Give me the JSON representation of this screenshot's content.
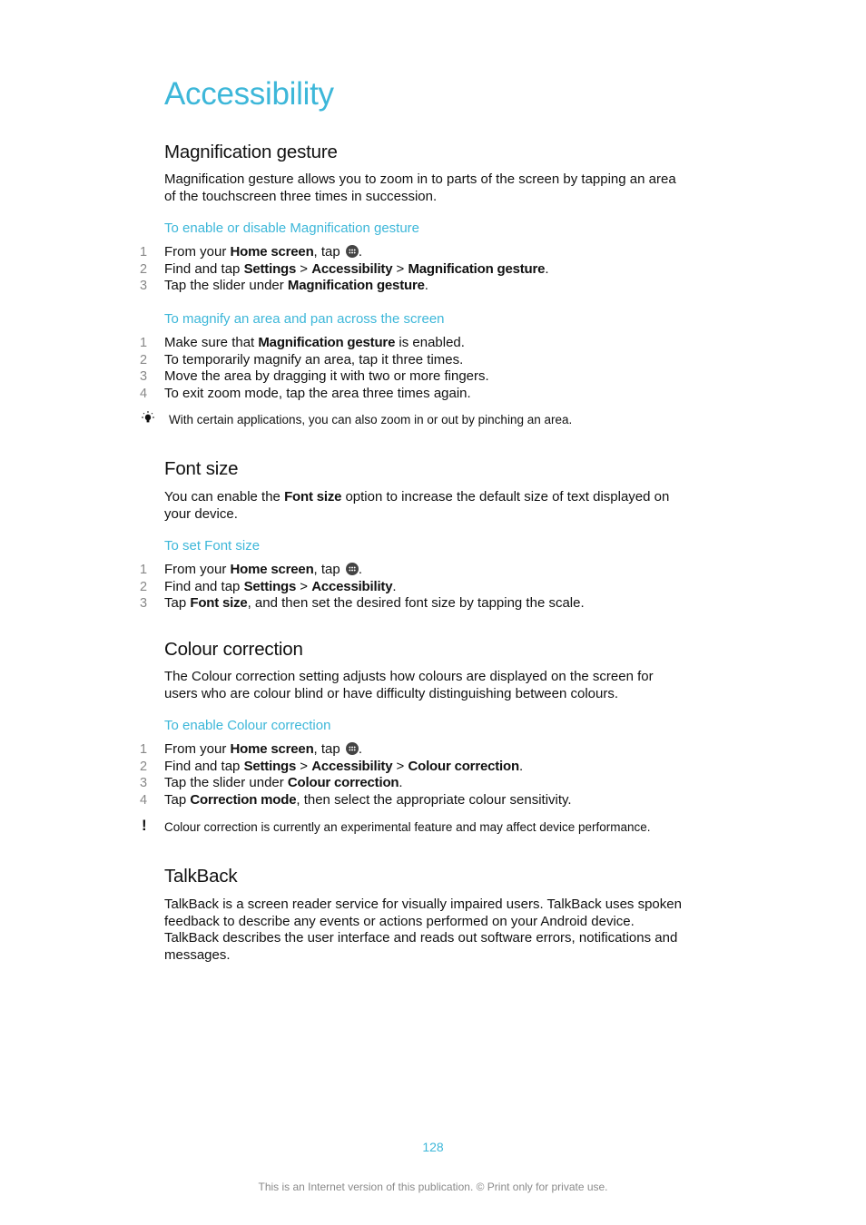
{
  "title": "Accessibility",
  "sections": {
    "magnification": {
      "heading": "Magnification gesture",
      "intro_line1": "Magnification gesture allows you to zoom in to parts of the screen by tapping an area",
      "intro_line2": "of the touchscreen three times in succession.",
      "proc1": {
        "title": "To enable or disable Magnification gesture",
        "steps": [
          {
            "num": "1",
            "pre": "From your ",
            "b1": "Home screen",
            "mid": ", tap ",
            "icon": "apps-icon",
            "post": "."
          },
          {
            "num": "2",
            "pre": "Find and tap ",
            "b1": "Settings",
            "sep1": " > ",
            "b2": "Accessibility",
            "sep2": " > ",
            "b3": "Magnification gesture",
            "post": "."
          },
          {
            "num": "3",
            "pre": "Tap the slider under ",
            "b1": "Magnification gesture",
            "post": "."
          }
        ]
      },
      "proc2": {
        "title": "To magnify an area and pan across the screen",
        "steps": [
          {
            "num": "1",
            "pre": "Make sure that ",
            "b1": "Magnification gesture",
            "post": " is enabled."
          },
          {
            "num": "2",
            "text": "To temporarily magnify an area, tap it three times."
          },
          {
            "num": "3",
            "text": "Move the area by dragging it with two or more fingers."
          },
          {
            "num": "4",
            "text": "To exit zoom mode, tap the area three times again."
          }
        ]
      },
      "tip": {
        "icon": "lightbulb-icon",
        "text": "With certain applications, you can also zoom in or out by pinching an area."
      }
    },
    "fontsize": {
      "heading": "Font size",
      "intro_pre": "You can enable the ",
      "intro_bold": "Font size",
      "intro_post": " option to increase the default size of text displayed on",
      "intro_line2": "your device.",
      "proc": {
        "title": "To set Font size",
        "steps": [
          {
            "num": "1",
            "pre": "From your ",
            "b1": "Home screen",
            "mid": ", tap ",
            "icon": "apps-icon",
            "post": "."
          },
          {
            "num": "2",
            "pre": "Find and tap ",
            "b1": "Settings",
            "sep1": " > ",
            "b2": "Accessibility",
            "post": "."
          },
          {
            "num": "3",
            "pre": "Tap ",
            "b1": "Font size",
            "post": ", and then set the desired font size by tapping the scale."
          }
        ]
      }
    },
    "colour": {
      "heading": "Colour correction",
      "intro_line1": "The Colour correction setting adjusts how colours are displayed on the screen for",
      "intro_line2": "users who are colour blind or have difficulty distinguishing between colours.",
      "proc": {
        "title": "To enable Colour correction",
        "steps": [
          {
            "num": "1",
            "pre": "From your ",
            "b1": "Home screen",
            "mid": ", tap ",
            "icon": "apps-icon",
            "post": "."
          },
          {
            "num": "2",
            "pre": "Find and tap ",
            "b1": "Settings",
            "sep1": " > ",
            "b2": "Accessibility",
            "sep2": " > ",
            "b3": "Colour correction",
            "post": "."
          },
          {
            "num": "3",
            "pre": "Tap the slider under ",
            "b1": "Colour correction",
            "post": "."
          },
          {
            "num": "4",
            "pre": "Tap ",
            "b1": "Correction mode",
            "post": ", then select the appropriate colour sensitivity."
          }
        ]
      },
      "warning": {
        "icon": "exclamation-icon",
        "text": "Colour correction is currently an experimental feature and may affect device performance."
      }
    },
    "talkback": {
      "heading": "TalkBack",
      "lines": [
        "TalkBack is a screen reader service for visually impaired users. TalkBack uses spoken",
        "feedback to describe any events or actions performed on your Android device.",
        "TalkBack describes the user interface and reads out software errors, notifications and",
        "messages."
      ]
    }
  },
  "page_number": "128",
  "footer": "This is an Internet version of this publication. © Print only for private use.",
  "colors": {
    "accent": "#3db7d9",
    "text": "#111111",
    "step_number": "#888888",
    "footer": "#8a8a8a"
  }
}
